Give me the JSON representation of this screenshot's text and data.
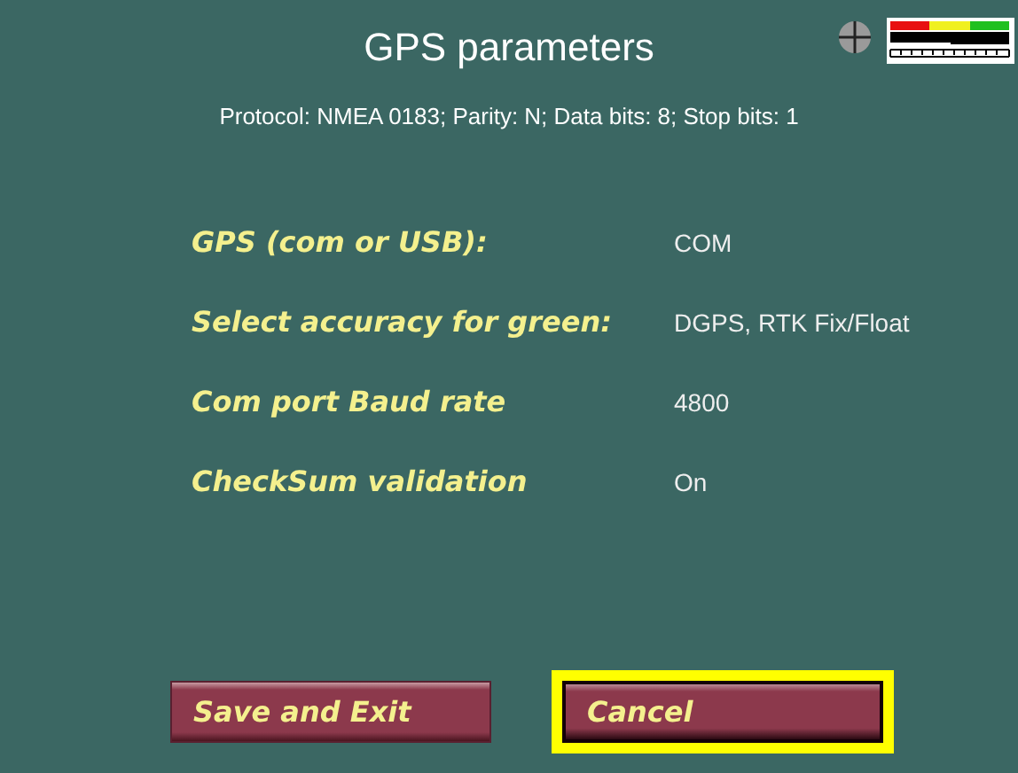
{
  "title": "GPS parameters",
  "protocol": "Protocol: NMEA 0183; Parity: N; Data bits: 8; Stop bits: 1",
  "parameters": [
    {
      "label": "GPS (com or USB):",
      "value": "COM"
    },
    {
      "label": "Select accuracy for green:",
      "value": "DGPS, RTK Fix/Float"
    },
    {
      "label": "Com port Baud rate",
      "value": "4800"
    },
    {
      "label": "CheckSum validation",
      "value": "On"
    }
  ],
  "buttons": [
    {
      "label": "Save and Exit",
      "selected": false
    },
    {
      "label": "Cancel",
      "selected": true
    }
  ]
}
